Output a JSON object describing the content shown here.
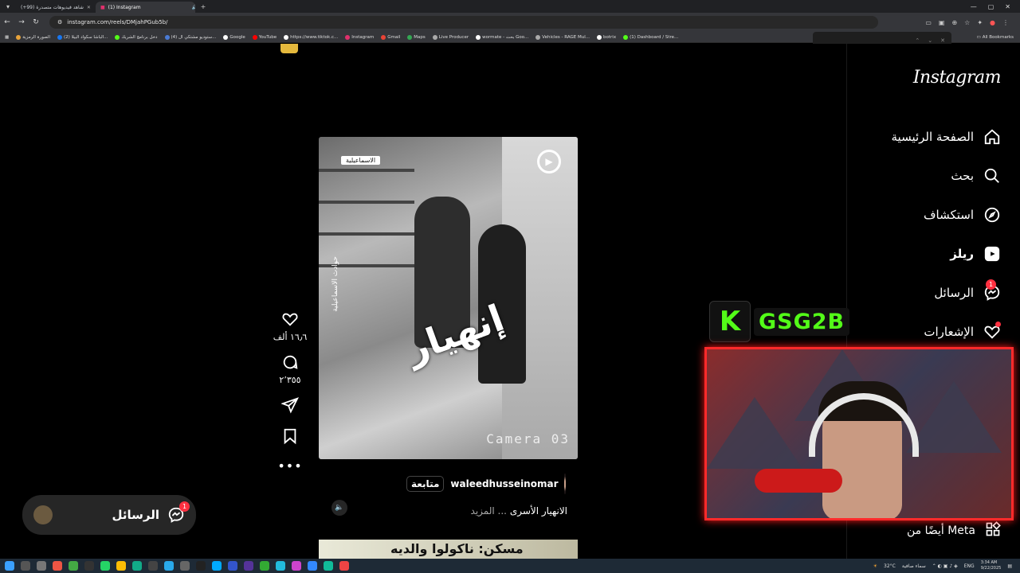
{
  "browser": {
    "tabs": [
      {
        "title": "(+99) شاهد فيديوهات متصدرة",
        "active": false
      },
      {
        "title": "(1) Instagram",
        "active": true
      }
    ],
    "new_tab": "+",
    "url": "instagram.com/reels/DMjahPGub5b/",
    "bookmarks": [
      {
        "label": "الصورة الرمزية",
        "color": "#e8a33a"
      },
      {
        "label": "(2) الباشا سكواد البيلا...",
        "color": "#1877f2"
      },
      {
        "label": "دخل برنامج الشريك",
        "color": "#53fc18"
      },
      {
        "label": "(4) ستوديو مشتكي ال...",
        "color": "#4a7bd6"
      },
      {
        "label": "Google",
        "color": "#ffffff"
      },
      {
        "label": "YouTube",
        "color": "#ff0000"
      },
      {
        "label": "https://www.tiktok.c...",
        "color": "#ffffff"
      },
      {
        "label": "Instagram",
        "color": "#e1306c"
      },
      {
        "label": "Gmail",
        "color": "#ea4335"
      },
      {
        "label": "Maps",
        "color": "#34a853"
      },
      {
        "label": "Live Producer",
        "color": "#aaaaaa"
      },
      {
        "label": "wormate - بحث Goo...",
        "color": "#ffffff"
      },
      {
        "label": "Vehicles - RAGE Mul...",
        "color": "#aaaaaa"
      },
      {
        "label": "botrix",
        "color": "#ffffff"
      },
      {
        "label": "(1) Dashboard / Stre...",
        "color": "#53fc18"
      }
    ],
    "all_bookmarks": "All Bookmarks"
  },
  "sidebar": {
    "logo": "Instagram",
    "items": [
      {
        "label": "الصفحة الرئيسية",
        "icon": "home-icon"
      },
      {
        "label": "بحث",
        "icon": "search-icon"
      },
      {
        "label": "استكشاف",
        "icon": "explore-icon"
      },
      {
        "label": "ريلز",
        "icon": "reels-icon"
      },
      {
        "label": "الرسائل",
        "icon": "messenger-icon",
        "badge": "1"
      },
      {
        "label": "الإشعارات",
        "icon": "heart-icon"
      }
    ],
    "meta_label": "أيضًا من Meta"
  },
  "reel": {
    "location_tag": "الاسماعيلية",
    "headline": "إنهيار",
    "side_text": "حوادث الاسماعيلية",
    "camera_text": "Camera 03",
    "likes": "١٦٫٦ ألف",
    "comments": "٢٬٣٥٥",
    "username": "waleedhusseinomar",
    "follow": "متابعة",
    "caption": "الانهيار الأسرى",
    "more": "... المزيد"
  },
  "next_reel_text": "مسكن: ناكولوا والديه",
  "messages_pill": {
    "label": "الرسائل",
    "badge": "1"
  },
  "overlay": {
    "brand": "GSG2B",
    "k": "K"
  },
  "taskbar": {
    "weather": "32°C",
    "weather_desc": "سماء صافية",
    "lang": "ENG",
    "time": "3:34 AM",
    "date": "9/22/2025"
  }
}
